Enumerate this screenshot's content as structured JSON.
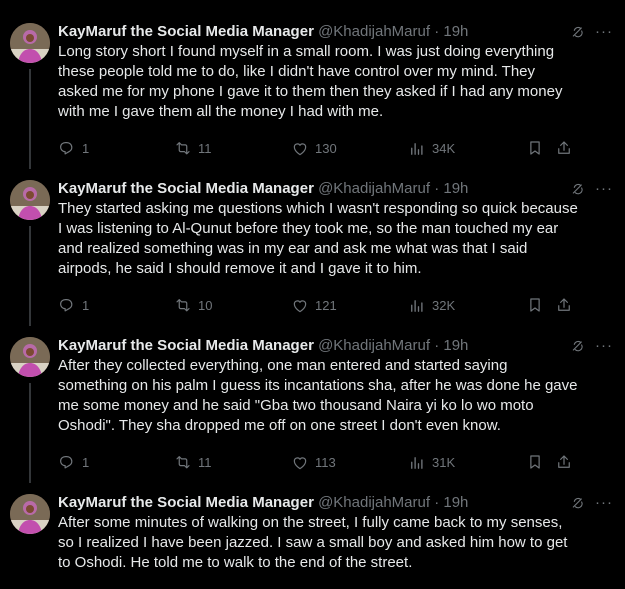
{
  "tweets": [
    {
      "name": "KayMaruf the Social Media Manager",
      "handle": "@KhadijahMaruf · 19h",
      "text": "Long story short I found myself in a small room. I was just doing everything these people told me to do, like I didn't have control over my mind. They asked me for my phone I gave it to them then they asked if I had any money with me I gave them all the money I had with me.",
      "replies": "1",
      "reposts": "11",
      "likes": "130",
      "views": "34K"
    },
    {
      "name": "KayMaruf the Social Media Manager",
      "handle": "@KhadijahMaruf · 19h",
      "text": "They started asking me questions which I wasn't responding so quick because I was listening to Al-Qunut before they took me, so the man touched my ear and realized something was in my ear and ask me what was that I said airpods, he said I should remove it and I gave it to him.",
      "replies": "1",
      "reposts": "10",
      "likes": "121",
      "views": "32K"
    },
    {
      "name": "KayMaruf the Social Media Manager",
      "handle": "@KhadijahMaruf · 19h",
      "text": "After they collected everything, one man entered and started saying something on his palm I guess its incantations sha, after he was done he gave me some money and he said \"Gba two thousand Naira yi ko lo wo moto Oshodi\".  They sha dropped me off on one street I don't even know.",
      "replies": "1",
      "reposts": "11",
      "likes": "113",
      "views": "31K"
    },
    {
      "name": "KayMaruf the Social Media Manager",
      "handle": "@KhadijahMaruf · 19h",
      "text": "After some minutes of walking on the street, I fully came back to my senses, so I realized I have been jazzed. I saw a small boy and asked him how to get to Oshodi. He told me to walk to the end of the street."
    }
  ],
  "icons": {
    "reply": "reply-icon",
    "repost": "repost-icon",
    "like": "heart-icon",
    "views": "views-icon",
    "bookmark": "bookmark-icon",
    "share": "share-icon",
    "grok": "grok-icon",
    "more": "more-icon"
  },
  "more_glyph": "···",
  "colors": {
    "background": "#000000",
    "text": "#e7e9ea",
    "muted": "#71767b",
    "divider": "#2f3336"
  }
}
